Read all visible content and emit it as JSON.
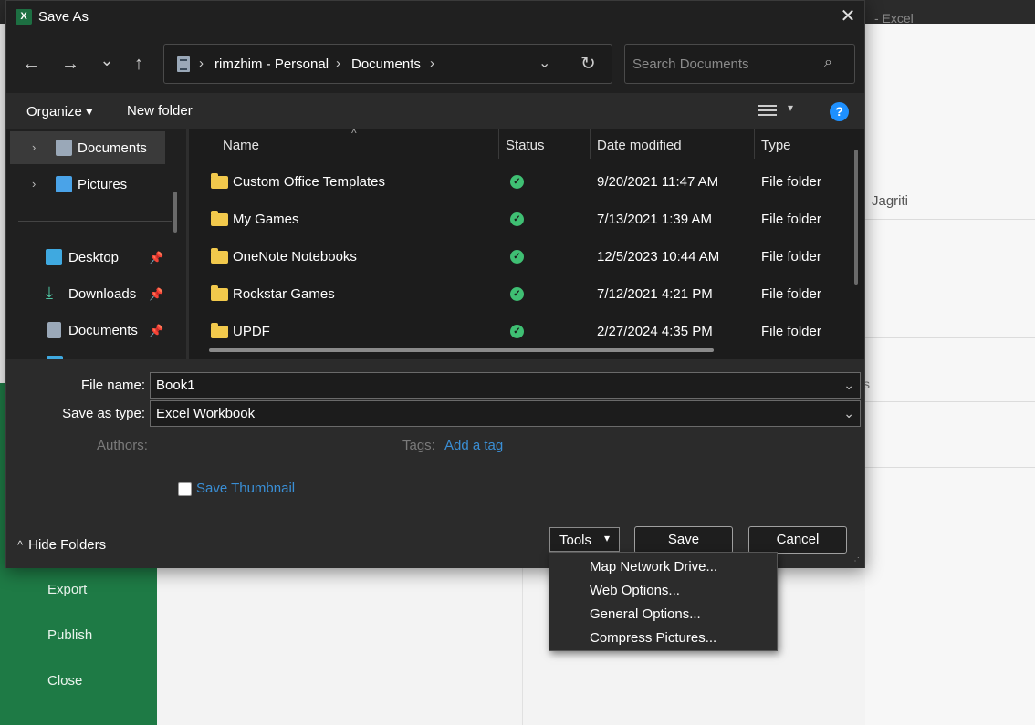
{
  "background": {
    "app_title": "-  Excel",
    "right_name": "Jagriti",
    "right_partial": "s",
    "nav_items": [
      "Export",
      "Publish",
      "Close"
    ]
  },
  "dialog": {
    "title": "Save As",
    "app_icon_letter": "X",
    "close_glyph": "✕",
    "nav": {
      "back": "←",
      "forward": "→",
      "recent": "⌄",
      "up": "↑"
    },
    "address": {
      "crumbs": [
        "rimzhim - Personal",
        "Documents"
      ],
      "separator": "›",
      "dropdown_glyph": "⌄",
      "refresh_glyph": "↻"
    },
    "search": {
      "placeholder": "Search Documents",
      "icon": "⌕"
    },
    "toolbar": {
      "organize": "Organize ▾",
      "new_folder": "New folder",
      "help": "?",
      "view_dropdown": "▾"
    },
    "nav_pane": {
      "quick_items": [
        {
          "label": "Documents",
          "chevron": "›",
          "icon": "documents-icon",
          "selected": true
        },
        {
          "label": "Pictures",
          "chevron": "›",
          "icon": "pictures-icon",
          "selected": false
        }
      ],
      "pinned_items": [
        {
          "label": "Desktop",
          "icon": "desktop-icon",
          "pin": "📌"
        },
        {
          "label": "Downloads",
          "icon": "downloads-icon",
          "pin": "📌"
        },
        {
          "label": "Documents",
          "icon": "documents-icon",
          "pin": "📌"
        }
      ]
    },
    "file_list": {
      "columns": [
        "Name",
        "Status",
        "Date modified",
        "Type"
      ],
      "sort_glyph": "^",
      "rows": [
        {
          "name": "Custom Office Templates",
          "status": "✓",
          "date": "9/20/2021 11:47 AM",
          "type": "File folder"
        },
        {
          "name": "My Games",
          "status": "✓",
          "date": "7/13/2021 1:39 AM",
          "type": "File folder"
        },
        {
          "name": "OneNote Notebooks",
          "status": "✓",
          "date": "12/5/2023 10:44 AM",
          "type": "File folder"
        },
        {
          "name": "Rockstar Games",
          "status": "✓",
          "date": "7/12/2021 4:21 PM",
          "type": "File folder"
        },
        {
          "name": "UPDF",
          "status": "✓",
          "date": "2/27/2024 4:35 PM",
          "type": "File folder"
        }
      ]
    },
    "form": {
      "file_name_label": "File name:",
      "file_name_value": "Book1",
      "save_type_label": "Save as type:",
      "save_type_value": "Excel Workbook",
      "dropdown_glyph": "⌄",
      "authors_label": "Authors:",
      "tags_label": "Tags:",
      "add_tag": "Add a tag",
      "save_thumbnail": "Save Thumbnail"
    },
    "footer": {
      "hide_folders": "Hide Folders",
      "hide_chevron": "^",
      "tools": "Tools",
      "tools_dropdown": "▾",
      "save": "Save",
      "cancel": "Cancel"
    },
    "tools_menu": [
      "Map Network Drive...",
      "Web Options...",
      "General Options...",
      "Compress Pictures..."
    ]
  }
}
